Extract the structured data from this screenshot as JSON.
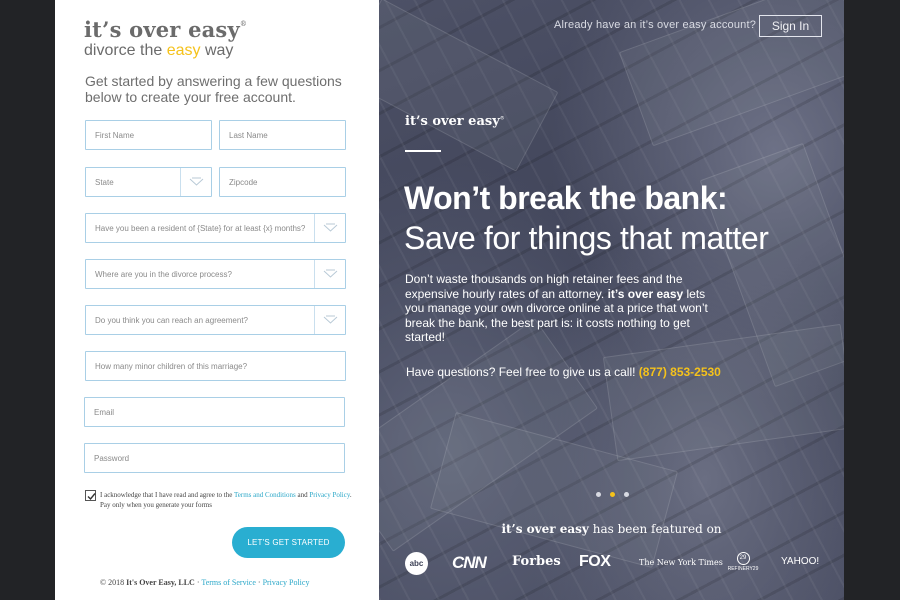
{
  "brand": {
    "name": "it’s over easy",
    "registered_mark": "®",
    "tagline_prefix": "divorce the ",
    "tagline_highlight": "easy",
    "tagline_suffix": " way"
  },
  "form": {
    "intro": "Get started by answering a few questions below to create your free account.",
    "first_name_placeholder": "First Name",
    "last_name_placeholder": "Last Name",
    "state_placeholder": "State",
    "zipcode_placeholder": "Zipcode",
    "residency_placeholder": "Have you been a resident of {State} for at least {x} months?",
    "process_placeholder": "Where are you in the divorce process?",
    "agreement_placeholder": "Do you think you can reach an agreement?",
    "children_placeholder": "How many minor children of this marriage?",
    "email_placeholder": "Email",
    "password_placeholder": "Password",
    "consent_checked": true,
    "consent_prefix": "I acknowledge that I have read and agree to the ",
    "terms_link": "Terms and Conditions",
    "consent_and": " and ",
    "privacy_link": "Privacy Policy",
    "consent_suffix": ". Pay only when you generate your forms",
    "cta_label": "LET'S GET STARTED"
  },
  "footer": {
    "copyright_prefix": "© 2018 ",
    "company": "It's Over Easy, LLC",
    "separator": " · ",
    "terms": "Terms of Service",
    "privacy": "Privacy Policy"
  },
  "hero": {
    "account_prompt": "Already have an it’s over easy account?",
    "signin_label": "Sign In",
    "logo": "it’s over easy",
    "logo_mark": "®",
    "headline": "Won’t break the bank:",
    "subhead": "Save for things that matter",
    "body_line1": "Don’t waste thousands on high retainer fees and the expensive hourly rates of an attorney. ",
    "body_brand": "it’s over easy",
    "body_line2": " lets you manage your own divorce online at a price that won’t break the bank, the best part is: it costs nothing to get started!",
    "questions_text": "Have questions? Feel free to give  us a call! ",
    "phone": "(877) 853-2530",
    "featured_brand": "it’s over easy",
    "featured_suffix": "  has been featured on",
    "press": {
      "abc": "abc",
      "cnn": "CNN",
      "forbes": "Forbes",
      "fox": "FOX",
      "nyt": "The New York Times",
      "refinery_mark": "29",
      "refinery": "REFINERY29",
      "yahoo": "YAHOO!"
    }
  },
  "colors": {
    "accent_yellow": "#f5c21b",
    "accent_blue": "#29aed1",
    "field_border": "#a9cfe6"
  },
  "carousel": {
    "slide_count": 3,
    "active_slide": 2
  }
}
